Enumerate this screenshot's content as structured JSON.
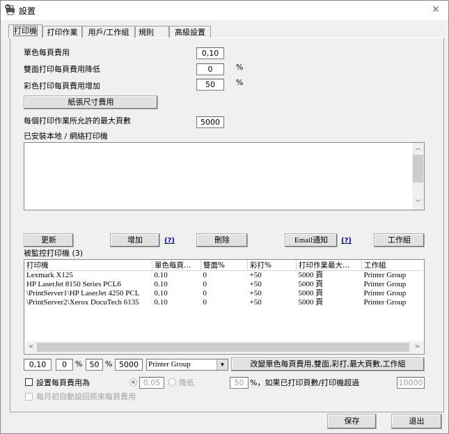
{
  "window": {
    "title": "設置",
    "close_label": "✕"
  },
  "tabs": [
    {
      "label": "打印機",
      "active": true
    },
    {
      "label": "打印作業"
    },
    {
      "label": "用戶/工作組"
    },
    {
      "label": "規則"
    },
    {
      "label": "高級設置"
    }
  ],
  "settings": {
    "mono_cost_label": "單色每頁費用",
    "mono_cost_value": "0,10",
    "duplex_label": "雙面打印每頁費用降低",
    "duplex_value": "0",
    "color_label": "彩色打印每頁費用增加",
    "color_value": "50",
    "percent": "%",
    "paper_size_button": "紙張尺寸費用",
    "max_pages_label": "每個打印作業所允許的最大頁數",
    "max_pages_value": "5000",
    "installed_printers_label": "已安裝本地 / 網絡打印機"
  },
  "actions": {
    "refresh": "更新",
    "add": "增加",
    "help": "(?)",
    "delete": "刪除",
    "email": "Email通知",
    "workgroup": "工作組"
  },
  "monitored": {
    "label": "被監控打印機 (3)",
    "columns": [
      "打印機",
      "單色每頁…",
      "雙面%",
      "彩打%",
      "打印作業最大…",
      "工作組"
    ],
    "rows": [
      [
        "Lexmark X125",
        "0.10",
        "0",
        "+50",
        "5000 頁",
        "Printer Group"
      ],
      [
        "HP LaserJet 8150 Series PCL6",
        "0.10",
        "0",
        "+50",
        "5000 頁",
        "Printer Group"
      ],
      [
        "\\PrintServer1\\HP LaserJet 4250 PCL",
        "0.10",
        "0",
        "+50",
        "5000 頁",
        "Printer Group"
      ],
      [
        "\\PrintServer2\\Xerox DocuTech 6135",
        "0.10",
        "0",
        "+50",
        "5000 頁",
        "Printer Group"
      ]
    ]
  },
  "edit_row": {
    "cost": "0,10",
    "duplex": "0",
    "color": "50",
    "max": "5000",
    "group": "Printer Group",
    "change_button": "改變單色每頁費用,雙面,彩打,最大頁數,工作組"
  },
  "bottom": {
    "set_cost_label": "設置每頁費用為",
    "rate_value": "0.05",
    "reduce_label": "降低",
    "reduce_value": "50",
    "threshold_label": "%，如果已打印頁數/打印機超過",
    "threshold_value": "10000",
    "reset_label": "每月初自動設回原來每頁費用"
  },
  "footer": {
    "save": "保存",
    "exit": "退出"
  }
}
